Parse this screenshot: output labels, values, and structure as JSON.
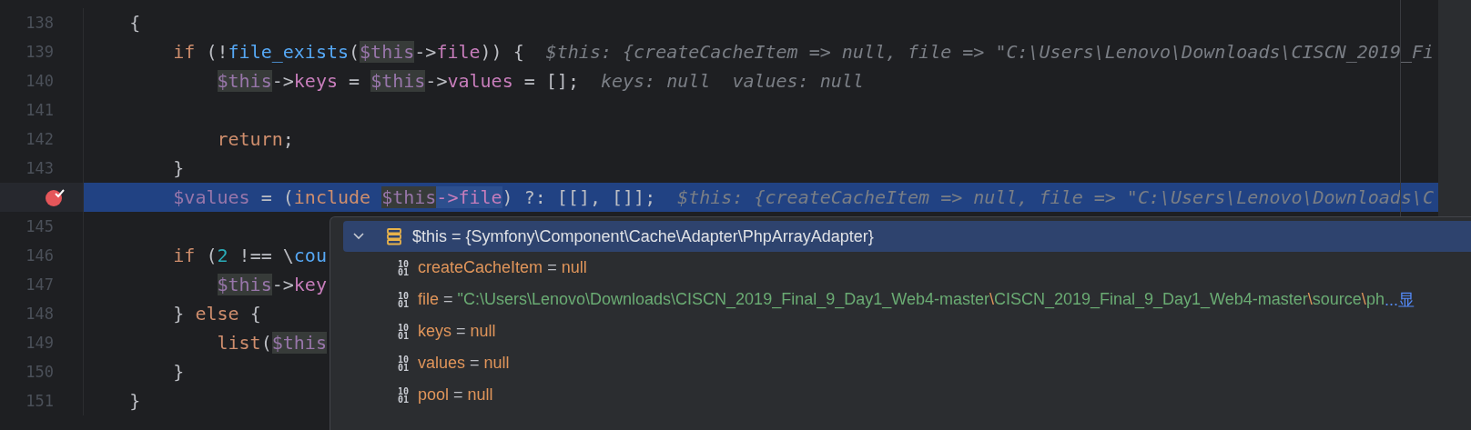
{
  "editor": {
    "lines": [
      {
        "number": "138",
        "selected": false,
        "breakpoint": false,
        "tokens": [
          {
            "kind": "punct",
            "text": "    {"
          }
        ]
      },
      {
        "number": "139",
        "selected": false,
        "breakpoint": false,
        "tokens": [
          {
            "kind": "keyword",
            "text": "        if"
          },
          {
            "kind": "punct",
            "text": " (!"
          },
          {
            "kind": "func",
            "text": "file_exists"
          },
          {
            "kind": "punct",
            "text": "("
          },
          {
            "kind": "this",
            "text": "$this"
          },
          {
            "kind": "punct",
            "text": "->"
          },
          {
            "kind": "prop",
            "text": "file"
          },
          {
            "kind": "punct",
            "text": ")) {"
          },
          {
            "kind": "hint",
            "text": "$this: {createCacheItem => null, file => \"C:\\Users\\Lenovo\\Downloads\\CISCN_2019_Fi"
          }
        ]
      },
      {
        "number": "140",
        "selected": false,
        "breakpoint": false,
        "tokens": [
          {
            "kind": "this",
            "text": "            $this"
          },
          {
            "kind": "punct",
            "text": "->"
          },
          {
            "kind": "prop",
            "text": "keys"
          },
          {
            "kind": "punct",
            "text": " = "
          },
          {
            "kind": "this",
            "text": "$this"
          },
          {
            "kind": "punct",
            "text": "->"
          },
          {
            "kind": "prop",
            "text": "values"
          },
          {
            "kind": "punct",
            "text": " = [];"
          },
          {
            "kind": "hint",
            "text": "keys: null"
          },
          {
            "kind": "hint",
            "text": "values: null"
          }
        ]
      },
      {
        "number": "141",
        "selected": false,
        "breakpoint": false
      },
      {
        "number": "142",
        "selected": false,
        "breakpoint": false,
        "tokens": [
          {
            "kind": "keyword",
            "text": "            return"
          },
          {
            "kind": "punct",
            "text": ";"
          }
        ]
      },
      {
        "number": "143",
        "selected": false,
        "breakpoint": false,
        "tokens": [
          {
            "kind": "punct",
            "text": "        }"
          }
        ]
      },
      {
        "selected": true,
        "breakpoint": true,
        "tokens": [
          {
            "kind": "var",
            "text": "        $values"
          },
          {
            "kind": "punct",
            "text": " = ("
          },
          {
            "kind": "keyword",
            "text": "include"
          },
          {
            "kind": "this",
            "text": " $this"
          },
          {
            "kind": "prop-sel",
            "text": "->file"
          },
          {
            "kind": "punct",
            "text": ") ?: [[], []];"
          },
          {
            "kind": "hint",
            "text": "$this: {createCacheItem => null, file => \"C:\\Users\\Lenovo\\Downloads\\C"
          }
        ]
      },
      {
        "number": "145",
        "selected": false,
        "breakpoint": false
      },
      {
        "number": "146",
        "selected": false,
        "breakpoint": false,
        "tokens": [
          {
            "kind": "keyword",
            "text": "        if"
          },
          {
            "kind": "punct",
            "text": " ("
          },
          {
            "kind": "num",
            "text": "2"
          },
          {
            "kind": "punct",
            "text": " !== \\"
          },
          {
            "kind": "func",
            "text": "cou"
          }
        ]
      },
      {
        "number": "147",
        "selected": false,
        "breakpoint": false,
        "tokens": [
          {
            "kind": "this",
            "text": "            $this"
          },
          {
            "kind": "punct",
            "text": "->"
          },
          {
            "kind": "prop",
            "text": "key"
          }
        ]
      },
      {
        "number": "148",
        "selected": false,
        "breakpoint": false,
        "tokens": [
          {
            "kind": "punct",
            "text": "        } "
          },
          {
            "kind": "keyword",
            "text": "else"
          },
          {
            "kind": "punct",
            "text": " {"
          }
        ]
      },
      {
        "number": "149",
        "selected": false,
        "breakpoint": false,
        "tokens": [
          {
            "kind": "keyword",
            "text": "            list"
          },
          {
            "kind": "punct",
            "text": "("
          },
          {
            "kind": "this",
            "text": "$this"
          }
        ]
      },
      {
        "number": "150",
        "selected": false,
        "breakpoint": false,
        "tokens": [
          {
            "kind": "punct",
            "text": "        }"
          }
        ]
      },
      {
        "number": "151",
        "selected": false,
        "breakpoint": false,
        "tokens": [
          {
            "kind": "punct",
            "text": "    }"
          }
        ]
      }
    ]
  },
  "popup": {
    "root": {
      "label": "$this = {Symfony\\Component\\Cache\\Adapter\\PhpArrayAdapter}",
      "expanded": true,
      "selected": true
    },
    "fields": [
      {
        "badge": "10\n01",
        "name": "createCacheItem",
        "equals": "=",
        "value": [
          {
            "kind": "keyword",
            "text": "null"
          }
        ]
      },
      {
        "badge": "10\n01",
        "name": "file",
        "equals": "=",
        "value": [
          {
            "kind": "str",
            "text": "\"C:\\Users\\Lenovo\\Downloads\\CISCN_2019_Final_9_Day1_Web4-master"
          },
          {
            "kind": "esc",
            "text": "\\"
          },
          {
            "kind": "str",
            "text": "CISCN_2019_Final_9_Day1_Web4-master"
          },
          {
            "kind": "esc",
            "text": "\\"
          },
          {
            "kind": "str",
            "text": "source"
          },
          {
            "kind": "esc",
            "text": "\\"
          },
          {
            "kind": "str",
            "text": "ph"
          }
        ],
        "link": "...显"
      },
      {
        "badge": "10\n01",
        "name": "keys",
        "equals": "=",
        "value": [
          {
            "kind": "keyword",
            "text": "null"
          }
        ]
      },
      {
        "badge": "10\n01",
        "name": "values",
        "equals": "=",
        "value": [
          {
            "kind": "keyword",
            "text": "null"
          }
        ]
      },
      {
        "badge": "10\n01",
        "name": "pool",
        "equals": "=",
        "value": [
          {
            "kind": "keyword",
            "text": "null"
          }
        ]
      }
    ]
  }
}
